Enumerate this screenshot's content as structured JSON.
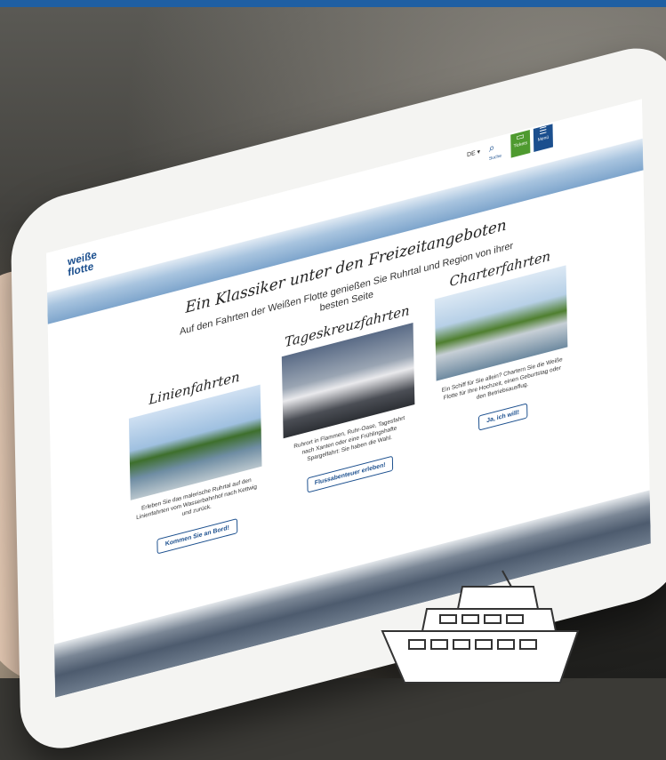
{
  "header": {
    "logo_line1": "weiße",
    "logo_line2": "flotte",
    "lang": "DE ▾",
    "search_label": "Suche",
    "tickets_label": "Tickets",
    "menu_label": "Menü"
  },
  "main": {
    "headline": "Ein Klassiker unter den Freizeitangeboten",
    "subline": "Auf den Fahrten der Weißen Flotte genießen Sie Ruhrtal und Region von ihrer besten Seite",
    "columns": [
      {
        "title": "Linienfahrten",
        "text": "Erleben Sie das malerische Ruhrtal auf den Linienfahrten vom Wasserbahnhof nach Kettwig und zurück.",
        "button": "Kommen Sie an Bord!"
      },
      {
        "title": "Tageskreuzfahrten",
        "text": "Ruhrort in Flammen, Ruhr-Oase, Tagesfahrt nach Xanten oder eine Frühlingshafte Spargelfahrt: Sie haben die Wahl.",
        "button": "Flussabenteuer erleben!"
      },
      {
        "title": "Charterfahrten",
        "text": "Ein Schiff für Sie allein? Chartern Sie die Weiße Flotte für Ihre Hochzeit, einen Geburtstag oder den Betriebsausflug.",
        "button": "Ja, ich will!"
      }
    ]
  },
  "colors": {
    "brand_blue": "#1b4f8e",
    "brand_green": "#4e9a2f",
    "topbar": "#1f5fa3"
  }
}
